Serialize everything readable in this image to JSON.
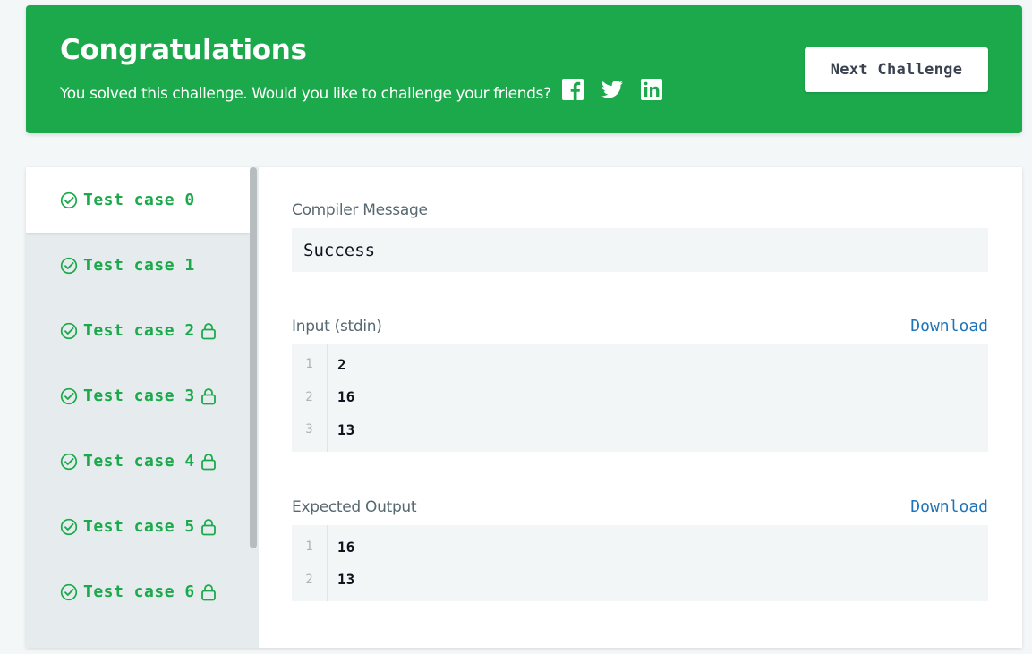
{
  "banner": {
    "title": "Congratulations",
    "subtitle": "You solved this challenge. Would you like to challenge your friends?",
    "social_icons": [
      "facebook-icon",
      "twitter-icon",
      "linkedin-icon"
    ],
    "next_button": "Next Challenge",
    "color": "#1ba94c"
  },
  "test_cases": [
    {
      "label": "Test case 0",
      "locked": false,
      "active": true
    },
    {
      "label": "Test case 1",
      "locked": false,
      "active": false
    },
    {
      "label": "Test case 2",
      "locked": true,
      "active": false
    },
    {
      "label": "Test case 3",
      "locked": true,
      "active": false
    },
    {
      "label": "Test case 4",
      "locked": true,
      "active": false
    },
    {
      "label": "Test case 5",
      "locked": true,
      "active": false
    },
    {
      "label": "Test case 6",
      "locked": true,
      "active": false
    }
  ],
  "compiler": {
    "label": "Compiler Message",
    "message": "Success"
  },
  "input": {
    "label": "Input (stdin)",
    "download": "Download",
    "lines": [
      {
        "num": "1",
        "text": "2"
      },
      {
        "num": "2",
        "text": "16"
      },
      {
        "num": "3",
        "text": "13"
      }
    ]
  },
  "expected": {
    "label": "Expected Output",
    "download": "Download",
    "lines": [
      {
        "num": "1",
        "text": "16"
      },
      {
        "num": "2",
        "text": "13"
      }
    ]
  }
}
